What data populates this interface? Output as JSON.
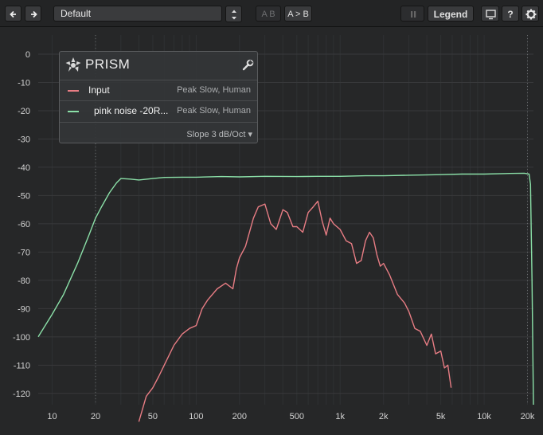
{
  "toolbar": {
    "back_icon": "arrow-left-icon",
    "forward_icon": "arrow-right-icon",
    "preset_name": "Default",
    "ab_label": "A B",
    "ab_copy_label": "A > B",
    "pause_icon": "pause-icon",
    "legend_label": "Legend",
    "display_icon": "monitor-icon",
    "help_label": "?",
    "settings_icon": "gear-icon"
  },
  "legend": {
    "title": "PRISM",
    "logo_icon": "prism-logo-icon",
    "settings_icon": "wrench-icon",
    "items": [
      {
        "name": "Input",
        "mode": "Peak Slow, Human",
        "color": "#e87d84"
      },
      {
        "name": "pink noise -20R...",
        "mode": "Peak Slow, Human",
        "color": "#8be0a8"
      }
    ],
    "slope": "Slope 3 dB/Oct ▾"
  },
  "chart_data": {
    "type": "line",
    "x_scale": "log",
    "xlim": [
      8,
      22000
    ],
    "ylim": [
      -124,
      0
    ],
    "xticks": [
      {
        "v": 10,
        "label": "10"
      },
      {
        "v": 20,
        "label": "20"
      },
      {
        "v": 50,
        "label": "50"
      },
      {
        "v": 100,
        "label": "100"
      },
      {
        "v": 200,
        "label": "200"
      },
      {
        "v": 500,
        "label": "500"
      },
      {
        "v": 1000,
        "label": "1k"
      },
      {
        "v": 2000,
        "label": "2k"
      },
      {
        "v": 5000,
        "label": "5k"
      },
      {
        "v": 10000,
        "label": "10k"
      },
      {
        "v": 20000,
        "label": "20k"
      }
    ],
    "yticks": [
      0,
      -10,
      -20,
      -30,
      -40,
      -50,
      -60,
      -70,
      -80,
      -90,
      -100,
      -110,
      -120
    ],
    "series": [
      {
        "name": "pink noise -20R...",
        "color": "#8be0a8",
        "x": [
          8,
          10,
          12,
          15,
          18,
          20,
          22,
          25,
          28,
          30,
          35,
          40,
          50,
          60,
          80,
          100,
          150,
          200,
          300,
          500,
          700,
          1000,
          1500,
          2000,
          3000,
          5000,
          7000,
          10000,
          15000,
          19000,
          20500,
          21000,
          21500,
          22000
        ],
        "y": [
          -100,
          -92,
          -85,
          -74,
          -64,
          -58,
          -54,
          -49,
          -45.5,
          -44,
          -44.2,
          -44.5,
          -44,
          -43.6,
          -43.5,
          -43.5,
          -43.3,
          -43.4,
          -43.2,
          -43.3,
          -43.2,
          -43.2,
          -43,
          -43,
          -42.8,
          -42.6,
          -42.4,
          -42.4,
          -42.2,
          -42.1,
          -42.4,
          -46,
          -80,
          -124
        ]
      },
      {
        "name": "Input",
        "color": "#e87d84",
        "x": [
          40,
          45,
          50,
          55,
          60,
          70,
          80,
          90,
          100,
          110,
          120,
          140,
          160,
          180,
          190,
          200,
          220,
          250,
          270,
          300,
          330,
          360,
          400,
          430,
          470,
          500,
          550,
          600,
          650,
          700,
          750,
          800,
          850,
          900,
          1000,
          1100,
          1200,
          1300,
          1400,
          1500,
          1600,
          1700,
          1800,
          1900,
          2000,
          2200,
          2500,
          2800,
          3000,
          3300,
          3600,
          4000,
          4300,
          4600,
          5000,
          5300,
          5600,
          5900
        ],
        "y": [
          -130,
          -121,
          -118,
          -114,
          -110,
          -103,
          -99,
          -97,
          -96,
          -90,
          -87,
          -83,
          -81,
          -83,
          -76,
          -72,
          -68,
          -58,
          -54,
          -53,
          -60,
          -62,
          -55,
          -56,
          -61,
          -61,
          -63,
          -56,
          -54,
          -52,
          -59,
          -64,
          -58,
          -60,
          -62,
          -66,
          -67,
          -74,
          -73,
          -66,
          -63,
          -65,
          -71,
          -75,
          -74,
          -78,
          -85,
          -88,
          -91,
          -97,
          -98,
          -103,
          -99,
          -106,
          -105,
          -111,
          -110,
          -118
        ]
      }
    ]
  }
}
